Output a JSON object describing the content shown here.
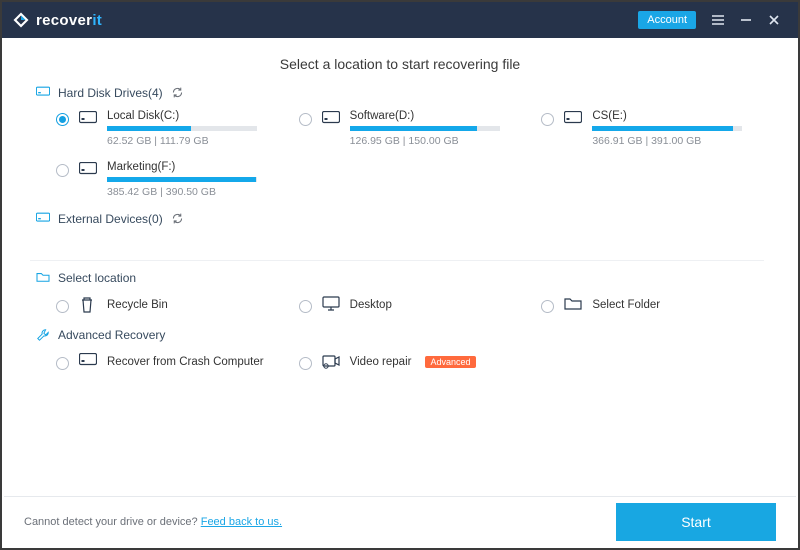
{
  "brand": {
    "name_a": "recover",
    "name_b": "it"
  },
  "titlebar": {
    "account": "Account"
  },
  "page_title": "Select a location to start recovering file",
  "sections": {
    "drives": {
      "label": "Hard Disk Drives(4)"
    },
    "external": {
      "label": "External Devices(0)"
    },
    "select": {
      "label": "Select location"
    },
    "advanced": {
      "label": "Advanced Recovery"
    }
  },
  "drives": [
    {
      "label": "Local Disk(C:)",
      "used": 62.52,
      "total": 111.79,
      "cap": "62.52  GB | 111.79  GB",
      "selected": true,
      "pct": 56
    },
    {
      "label": "Software(D:)",
      "used": 126.95,
      "total": 150.0,
      "cap": "126.95  GB | 150.00  GB",
      "selected": false,
      "pct": 85
    },
    {
      "label": "CS(E:)",
      "used": 366.91,
      "total": 391.0,
      "cap": "366.91  GB | 391.00  GB",
      "selected": false,
      "pct": 94
    },
    {
      "label": "Marketing(F:)",
      "used": 385.42,
      "total": 390.5,
      "cap": "385.42  GB | 390.50  GB",
      "selected": false,
      "pct": 99
    }
  ],
  "locations": [
    {
      "label": "Recycle Bin",
      "icon": "trash"
    },
    {
      "label": "Desktop",
      "icon": "desktop"
    },
    {
      "label": "Select Folder",
      "icon": "folder"
    }
  ],
  "advanced": [
    {
      "label": "Recover from Crash Computer",
      "icon": "drive",
      "badge": ""
    },
    {
      "label": "Video repair",
      "icon": "video",
      "badge": "Advanced"
    }
  ],
  "footer": {
    "text": "Cannot detect your drive or device? ",
    "link": "Feed back to us.",
    "start": "Start"
  }
}
